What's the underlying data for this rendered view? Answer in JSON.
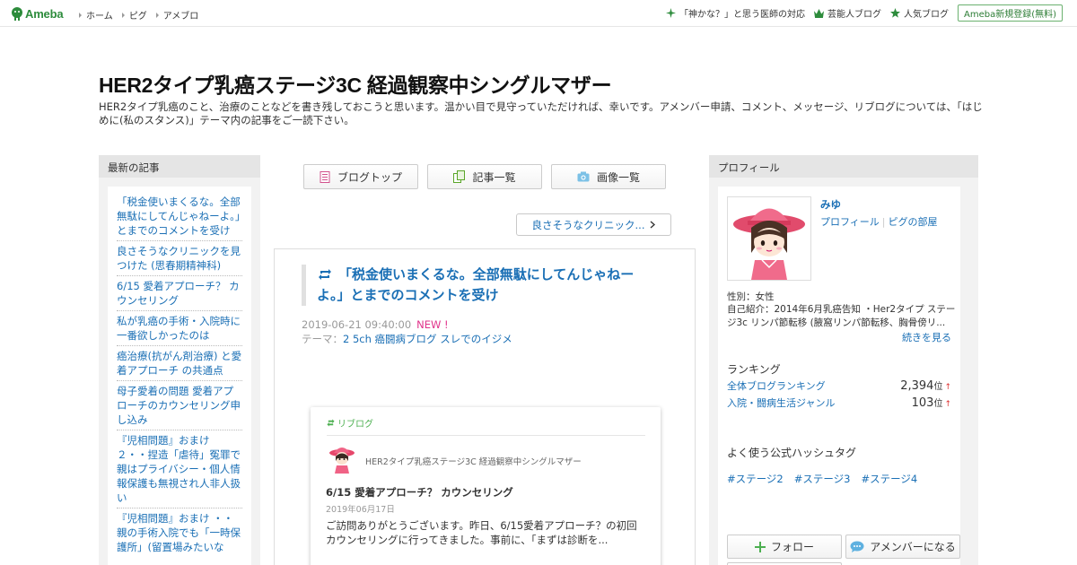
{
  "header": {
    "logo_text": "Ameba",
    "nav": [
      {
        "label": "ホーム"
      },
      {
        "label": "ピグ"
      },
      {
        "label": "アメブロ"
      }
    ],
    "right_links": [
      {
        "label": "「神かな？」と思う医師の対応",
        "icon": "sparkle-icon"
      },
      {
        "label": "芸能人ブログ",
        "icon": "crown-icon"
      },
      {
        "label": "人気ブログ",
        "icon": "star-icon"
      }
    ],
    "signup_label": "Ameba新規登録(無料)"
  },
  "blog": {
    "title": "HER2タイプ乳癌ステージ3C 経過観察中シングルマザー",
    "description": "HER2タイプ乳癌のこと、治療のことなどを書き残しておこうと思います。温かい目で見守っていただければ、幸いです。アメンバー申請、コメント、メッセージ、リブログについては、「はじめに(私のスタンス)」テーマ内の記事をご一読下さい。"
  },
  "recent": {
    "heading": "最新の記事",
    "items": [
      "「税金使いまくるな。全部無駄にしてんじゃねーよ。」とまでのコメントを受け",
      "良さそうなクリニックを見つけた (思春期精神科)",
      "6/15 愛着アプローチ？ カウンセリング",
      "私が乳癌の手術・入院時に一番欲しかったのは",
      "癌治療(抗がん剤治療) と愛着アプローチ の共通点",
      "母子愛着の問題 愛着アプローチのカウンセリング申し込み",
      "『児相問題』おまけ ２・・捏造「虐待」冤罪で親はプライバシー・個人情報保護も無視され人非人扱い",
      "『児相問題』おまけ ・・親の手術入院でも「一時保護所」(留置場みたいな"
    ]
  },
  "tabs": {
    "top": "ブログトップ",
    "list": "記事一覧",
    "images": "画像一覧"
  },
  "pager": {
    "next_label": "良さそうなクリニック..."
  },
  "article": {
    "title": "「税金使いまくるな。全部無駄にしてんじゃねーよ。」とまでのコメントを受け",
    "date": "2019-06-21 09:40:00",
    "new_badge": "NEW !",
    "theme_prefix": "テーマ：",
    "theme": "2 5ch 癌闘病ブログ スレでのイジメ"
  },
  "reblog": {
    "label": "リブログ",
    "blog_name": "HER2タイプ乳癌ステージ3C 経過観察中シングルマザー",
    "title": "6/15 愛着アプローチ？ カウンセリング",
    "date": "2019年06月17日",
    "body": "ご訪問ありがとうございます。昨日、6/15愛着アプローチ？の初回カウンセリングに行ってきました。事前に、「まずは診断を..."
  },
  "profile": {
    "heading": "プロフィール",
    "name": "みゆ",
    "link_profile": "プロフィール",
    "link_room": "ピグの部屋",
    "sex": "性別：女性",
    "intro": "自己紹介：2014年6月乳癌告知 ・Her2タイプ ステージ3c リンパ節転移 (腋窩リンパ節転移、胸骨傍リ...",
    "more": "続きを見る"
  },
  "ranking": {
    "heading": "ランキング",
    "rows": [
      {
        "label": "全体ブログランキング",
        "value": "2,394",
        "unit": "位",
        "trend": "↑"
      },
      {
        "label": "入院・闘病生活ジャンル",
        "value": "103",
        "unit": "位",
        "trend": "↑"
      }
    ]
  },
  "hashtags": {
    "heading": "よく使う公式ハッシュタグ",
    "items": [
      "#ステージ2",
      "#ステージ3",
      "#ステージ4"
    ]
  },
  "actions": {
    "follow": "フォロー",
    "amember": "アメンバーになる"
  },
  "colors": {
    "brand_green": "#2d8c3c",
    "link_blue": "#1a6fb5",
    "new_pink": "#e0328a"
  }
}
